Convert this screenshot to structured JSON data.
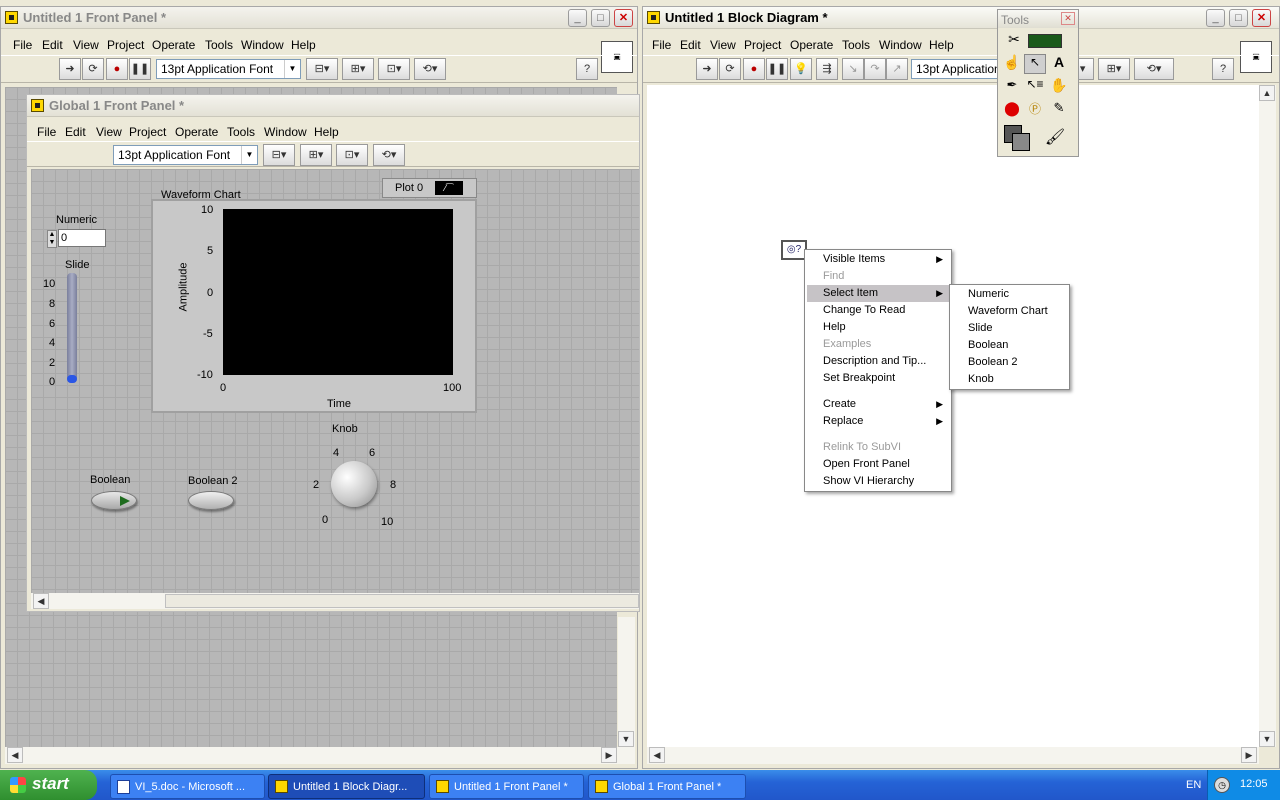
{
  "menu_items": [
    "File",
    "Edit",
    "View",
    "Project",
    "Operate",
    "Tools",
    "Window",
    "Help"
  ],
  "font_selector": "13pt Application Font",
  "front_panel": {
    "title": "Untitled 1 Front Panel *"
  },
  "global_panel": {
    "title": "Global 1 Front Panel *",
    "numeric": {
      "label": "Numeric",
      "value": "0"
    },
    "slide": {
      "label": "Slide",
      "ticks": [
        "10",
        "8",
        "6",
        "4",
        "2",
        "0"
      ],
      "value": 0
    },
    "chart": {
      "title": "Waveform Chart",
      "legend": "Plot 0",
      "ylabel": "Amplitude",
      "xlabel": "Time",
      "yticks": [
        "10",
        "5",
        "0",
        "-5",
        "-10"
      ],
      "xticks": [
        "0",
        "100"
      ]
    },
    "knob": {
      "label": "Knob",
      "ticks": [
        "4",
        "6",
        "2",
        "8",
        "0",
        "10"
      ]
    },
    "boolean1": "Boolean",
    "boolean2": "Boolean 2"
  },
  "block_diagram": {
    "title": "Untitled 1 Block Diagram *"
  },
  "tools_palette": {
    "title": "Tools"
  },
  "context_menu": {
    "items": [
      {
        "label": "Visible Items",
        "submenu": true,
        "disabled": false
      },
      {
        "label": "Find",
        "submenu": false,
        "disabled": true
      },
      {
        "label": "Select Item",
        "submenu": true,
        "disabled": false,
        "highlight": true
      },
      {
        "label": "Change To Read",
        "submenu": false,
        "disabled": false
      },
      {
        "label": "Help",
        "submenu": false,
        "disabled": false
      },
      {
        "label": "Examples",
        "submenu": false,
        "disabled": true
      },
      {
        "label": "Description and Tip...",
        "submenu": false,
        "disabled": false
      },
      {
        "label": "Set Breakpoint",
        "submenu": false,
        "disabled": false
      },
      {
        "label": "Create",
        "submenu": true,
        "disabled": false
      },
      {
        "label": "Replace",
        "submenu": true,
        "disabled": false
      },
      {
        "label": "Relink To SubVI",
        "submenu": false,
        "disabled": true
      },
      {
        "label": "Open Front Panel",
        "submenu": false,
        "disabled": false
      },
      {
        "label": "Show VI Hierarchy",
        "submenu": false,
        "disabled": false
      }
    ],
    "submenu": [
      "Numeric",
      "Waveform Chart",
      "Slide",
      "Boolean",
      "Boolean 2",
      "Knob"
    ]
  },
  "taskbar": {
    "start": "start",
    "tasks": [
      "VI_5.doc - Microsoft ...",
      "Untitled 1 Block Diagr...",
      "Untitled 1 Front Panel *",
      "Global 1 Front Panel *"
    ],
    "lang": "EN",
    "clock": "12:05"
  }
}
